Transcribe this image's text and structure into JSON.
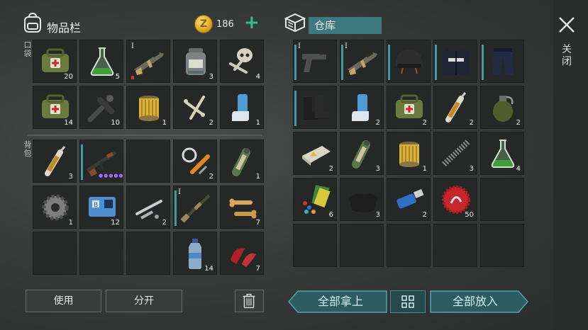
{
  "header": {
    "inventory_title": "物品栏",
    "coins": "186",
    "plus": "+",
    "storage_title": "仓库",
    "close_label": "关闭"
  },
  "sections": {
    "pockets": "口袋",
    "backpack": "背包"
  },
  "tier_mark": "I",
  "inventory": {
    "pockets": [
      {
        "icon": "medkit-bag-icon",
        "count": "20"
      },
      {
        "icon": "flask-icon",
        "count": "5"
      },
      {
        "icon": "rifle-icon",
        "count": ""
      },
      {
        "icon": "jar-icon",
        "count": "3"
      },
      {
        "icon": "skull-parts-icon",
        "count": "4"
      },
      {
        "icon": "medkit-bag-icon",
        "count": "14"
      },
      {
        "icon": "pipe-icon",
        "count": "10"
      },
      {
        "icon": "filter-icon",
        "count": "1"
      },
      {
        "icon": "bones-icon",
        "count": "2"
      },
      {
        "icon": "inhaler-icon",
        "count": "1"
      }
    ],
    "backpack": [
      {
        "icon": "ampoule-icon",
        "count": "3"
      },
      {
        "icon": "ak-rifle-icon",
        "count": ""
      },
      {
        "icon": "empty",
        "count": ""
      },
      {
        "icon": "spring-parts-icon",
        "count": "2"
      },
      {
        "icon": "green-tube-icon",
        "count": "1"
      },
      {
        "icon": "gear-icon",
        "count": "1"
      },
      {
        "icon": "keycard-icon",
        "count": "12"
      },
      {
        "icon": "pipes-icon",
        "count": "2"
      },
      {
        "icon": "shotgun-icon",
        "count": ""
      },
      {
        "icon": "dog-bones-icon",
        "count": "7"
      },
      {
        "icon": "empty",
        "count": ""
      },
      {
        "icon": "empty",
        "count": ""
      },
      {
        "icon": "empty",
        "count": ""
      },
      {
        "icon": "water-bottle-icon",
        "count": "14"
      },
      {
        "icon": "meat-icon",
        "count": "7"
      }
    ]
  },
  "storage": [
    {
      "icon": "pistol-icon",
      "count": ""
    },
    {
      "icon": "rifle-icon",
      "count": ""
    },
    {
      "icon": "helmet-icon",
      "count": ""
    },
    {
      "icon": "police-vest-icon",
      "count": ""
    },
    {
      "icon": "pants-icon",
      "count": ""
    },
    {
      "icon": "boots-icon",
      "count": ""
    },
    {
      "icon": "inhaler-icon",
      "count": "2"
    },
    {
      "icon": "medkit-bag-icon",
      "count": "2"
    },
    {
      "icon": "ampoule-icon",
      "count": "2"
    },
    {
      "icon": "grenade-icon",
      "count": "2"
    },
    {
      "icon": "soap-icon",
      "count": "2"
    },
    {
      "icon": "green-tube-icon",
      "count": "3"
    },
    {
      "icon": "filter-icon",
      "count": "1"
    },
    {
      "icon": "spring-icon",
      "count": "3"
    },
    {
      "icon": "flask-icon",
      "count": "4"
    },
    {
      "icon": "pills-icon",
      "count": "6"
    },
    {
      "icon": "cloth-icon",
      "count": "3"
    },
    {
      "icon": "usb-icon",
      "count": "2"
    },
    {
      "icon": "bottle-cap-icon",
      "count": "50"
    }
  ],
  "buttons": {
    "use": "使用",
    "split": "分开",
    "take_all": "全部拿上",
    "put_all": "全部放入"
  },
  "colors": {
    "accent": "#3c7a80",
    "plus": "#33c08a",
    "coin": "#d9a521"
  }
}
